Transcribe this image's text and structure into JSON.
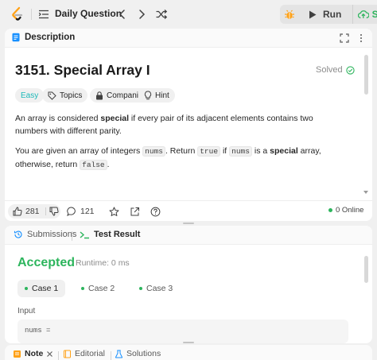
{
  "topbar": {
    "problem_list_label": "Daily Question",
    "run_label": "Run",
    "submit_label": "Su"
  },
  "description_panel": {
    "tab_label": "Description",
    "title": "3151. Special Array I",
    "solved_label": "Solved",
    "tags": {
      "difficulty": "Easy",
      "topics": "Topics",
      "companies": "Companies",
      "hint": "Hint"
    },
    "paragraph1": {
      "a": "An array is considered ",
      "b": "special",
      "c": " if every pair of its adjacent elements contains two numbers with different parity."
    },
    "paragraph2": {
      "a": "You are given an array of integers ",
      "code1": "nums",
      "b": ". Return ",
      "code2": "true",
      "c": " if ",
      "code3": "nums",
      "d": " is a ",
      "e": "special",
      "f": " array, otherwise, return ",
      "code4": "false",
      "g": "."
    },
    "footer": {
      "likes": "281",
      "comments": "121",
      "online": "0 Online"
    }
  },
  "result_panel": {
    "tabs": {
      "submissions": "Submissions",
      "test_result": "Test Result"
    },
    "status": "Accepted",
    "runtime": "Runtime: 0 ms",
    "cases": [
      "Case 1",
      "Case 2",
      "Case 3"
    ],
    "input_label": "Input",
    "input_var": "nums ="
  },
  "bottom_tabs": {
    "note": "Note",
    "editorial": "Editorial",
    "solutions": "Solutions"
  },
  "colors": {
    "accent_green": "#2db55d",
    "easy_teal": "#1cb8b8",
    "logo_orange": "#ffa116"
  }
}
